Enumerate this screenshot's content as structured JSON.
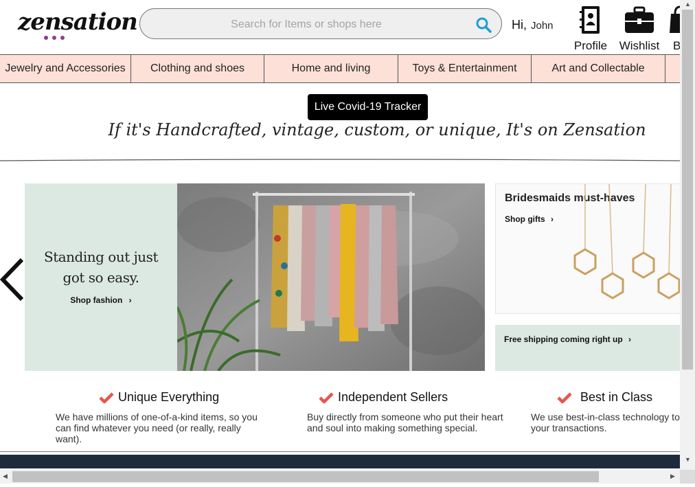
{
  "header": {
    "logo_text": "zensation",
    "search": {
      "placeholder": "Search for Items or shops here",
      "value": ""
    },
    "greeting": "Hi,",
    "user_name": "John",
    "profile_label": "Profile",
    "wishlist_label": "Wishlist",
    "bag_label": "B"
  },
  "categories": [
    "Jewelry and Accessories",
    "Clothing and shoes",
    "Home and living",
    "Toys & Entertainment",
    "Art and Collectable",
    ""
  ],
  "covid_button": "Live Covid-19 Tracker",
  "tagline": "If it's Handcrafted, vintage, custom, or unique, It's on Zensation",
  "hero": {
    "headline": "Standing out just got so easy.",
    "link": "Shop fashion",
    "link_arrow": "›"
  },
  "side_promos": {
    "top_title": "Bridesmaids must-haves",
    "top_link": "Shop gifts",
    "top_arrow": "›",
    "bottom_link": "Free shipping coming right up",
    "bottom_arrow": "›"
  },
  "features": [
    {
      "title": "Unique Everything",
      "desc": "We have millions of one-of-a-kind items, so you can find whatever you need (or really, really want)."
    },
    {
      "title": "Independent Sellers",
      "desc": "Buy directly from someone who put their heart and soul into making something special."
    },
    {
      "title": "Best in Class",
      "desc": "We use best-in-class technology to your transactions."
    }
  ],
  "colors": {
    "category_bg": "#fde0d8",
    "hero_bg": "#dce9e2",
    "check": "#e8554e",
    "search_icon": "#1e9bd7",
    "logo_dots": "#8e3d8e",
    "footer_band": "#1e2b3c"
  },
  "icons": {
    "search": "search-icon",
    "profile": "contact-book-icon",
    "wishlist": "briefcase-icon",
    "bag": "shopping-bag-icon",
    "prev": "chevron-left-icon",
    "feature_check": "check-icon"
  }
}
